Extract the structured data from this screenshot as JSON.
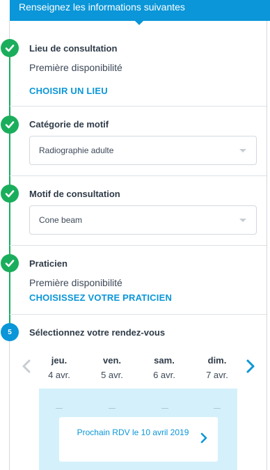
{
  "header": {
    "title": "Renseignez les informations suivantes"
  },
  "steps": {
    "lieu": {
      "title": "Lieu de consultation",
      "value": "Première disponibilité",
      "action": "CHOISIR UN LIEU"
    },
    "categorie": {
      "title": "Catégorie de motif",
      "selected": "Radiographie adulte"
    },
    "motif": {
      "title": "Motif de consultation",
      "selected": "Cone beam"
    },
    "praticien": {
      "title": "Praticien",
      "value": "Première disponibilité",
      "action": "CHOISISSEZ VOTRE PRATICIEN"
    },
    "rdv": {
      "number": "5",
      "title": "Sélectionnez votre rendez-vous"
    }
  },
  "calendar": {
    "days": [
      {
        "name": "jeu.",
        "date": "4 avr."
      },
      {
        "name": "ven.",
        "date": "5 avr."
      },
      {
        "name": "sam.",
        "date": "6 avr."
      },
      {
        "name": "dim.",
        "date": "7 avr."
      }
    ],
    "next_appointment": "Prochain RDV le 10 avril 2019"
  },
  "colors": {
    "primary": "#0a96d8",
    "success": "#1aae5c",
    "slots_bg": "#d4f1fb"
  },
  "icons": {
    "step_done": "check-icon",
    "prev": "chevron-left-icon",
    "next": "chevron-right-icon"
  }
}
